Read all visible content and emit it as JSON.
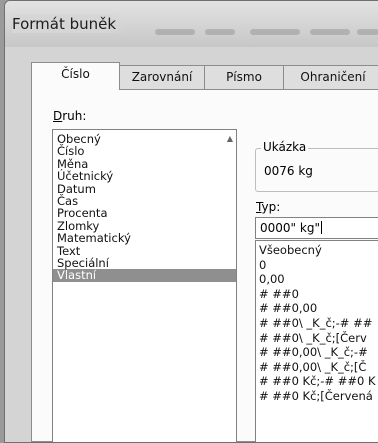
{
  "dialog": {
    "title": "Formát buněk"
  },
  "tabs": [
    {
      "label": "Číslo"
    },
    {
      "label": "Zarovnání"
    },
    {
      "label": "Písmo"
    },
    {
      "label": "Ohraničení"
    }
  ],
  "druh": {
    "label": "Druh:",
    "items": [
      "Obecný",
      "Číslo",
      "Měna",
      "Účetnický",
      "Datum",
      "Čas",
      "Procenta",
      "Zlomky",
      "Matematický",
      "Text",
      "Speciální",
      "Vlastní"
    ],
    "selected": "Vlastní"
  },
  "sample": {
    "group_label": "Ukázka",
    "value": "0076 kg"
  },
  "typ": {
    "label": "Typ:",
    "value": "0000\" kg\"",
    "formats": [
      "Všeobecný",
      "0",
      "0,00",
      "# ##0",
      "# ##0,00",
      "# ##0\\ _K_č;-# ##",
      "# ##0\\ _K_č;[Červ",
      "# ##0,00\\ _K_č;-#",
      "# ##0,00\\ _K_č;[Č",
      "# ##0 Kč;-# ##0 K",
      "# ##0 Kč;[Červená"
    ]
  }
}
